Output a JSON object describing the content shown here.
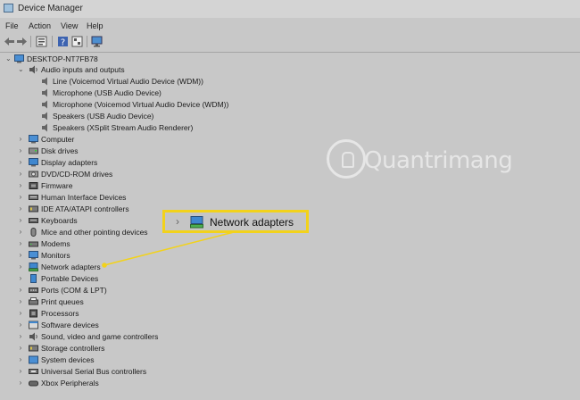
{
  "window": {
    "title": "Device Manager",
    "icon": "device-manager-icon"
  },
  "menu": [
    "File",
    "Action",
    "View",
    "Help"
  ],
  "toolbar": {
    "buttons": [
      "back-icon",
      "forward-icon",
      "properties-icon",
      "help-icon",
      "show-hidden-icon",
      "monitor-icon"
    ]
  },
  "tree": {
    "root": "DESKTOP-NT7FB78",
    "audio": {
      "label": "Audio inputs and outputs",
      "children": [
        "Line (Voicemod Virtual Audio Device (WDM))",
        "Microphone (USB Audio Device)",
        "Microphone (Voicemod Virtual Audio Device (WDM))",
        "Speakers (USB Audio Device)",
        "Speakers (XSplit Stream Audio Renderer)"
      ]
    },
    "categories": [
      "Computer",
      "Disk drives",
      "Display adapters",
      "DVD/CD-ROM drives",
      "Firmware",
      "Human Interface Devices",
      "IDE ATA/ATAPI controllers",
      "Keyboards",
      "Mice and other pointing devices",
      "Modems",
      "Monitors",
      "Network adapters",
      "Portable Devices",
      "Ports (COM & LPT)",
      "Print queues",
      "Processors",
      "Software devices",
      "Sound, video and game controllers",
      "Storage controllers",
      "System devices",
      "Universal Serial Bus controllers",
      "Xbox Peripherals"
    ]
  },
  "callout": {
    "label": "Network adapters",
    "color": "#f2d21b"
  },
  "watermark": {
    "text": "Quantrimang"
  }
}
